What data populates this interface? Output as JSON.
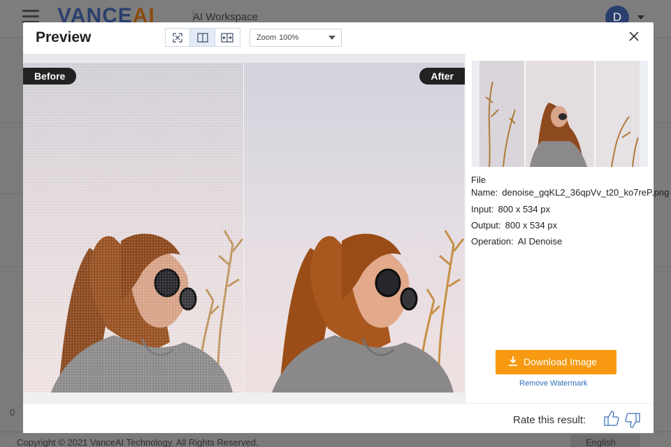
{
  "background_app": {
    "logo_main": "VANCE",
    "logo_accent": "AI",
    "workspace_label": "AI Workspace",
    "avatar_initial": "D",
    "item_count": "0",
    "copyright": "Copyright © 2021 VanceAI Technology. All Rights Reserved.",
    "language": "English"
  },
  "modal": {
    "title": "Preview",
    "view_modes": [
      "fit-screen-icon",
      "split-view-icon",
      "side-by-side-icon"
    ],
    "active_view_mode": "split-view-icon",
    "zoom_label": "Zoom",
    "zoom_value": "100%",
    "before_label": "Before",
    "after_label": "After"
  },
  "details": {
    "file_name_label": "File Name:",
    "file_name": "denoise_gqKL2_36qpVv_t20_ko7reP.png",
    "input_label": "Input:",
    "input_value": "800 x 534 px",
    "output_label": "Output:",
    "output_value": "800 x 534 px",
    "operation_label": "Operation:",
    "operation_value": "AI Denoise"
  },
  "actions": {
    "download_label": "Download Image",
    "remove_watermark_label": "Remove Watermark"
  },
  "rating": {
    "prompt": "Rate this result:"
  },
  "colors": {
    "accent": "#f79a12",
    "link": "#2f6fb7",
    "tag_bg": "#222222",
    "brand_blue": "#2b3f6e"
  }
}
